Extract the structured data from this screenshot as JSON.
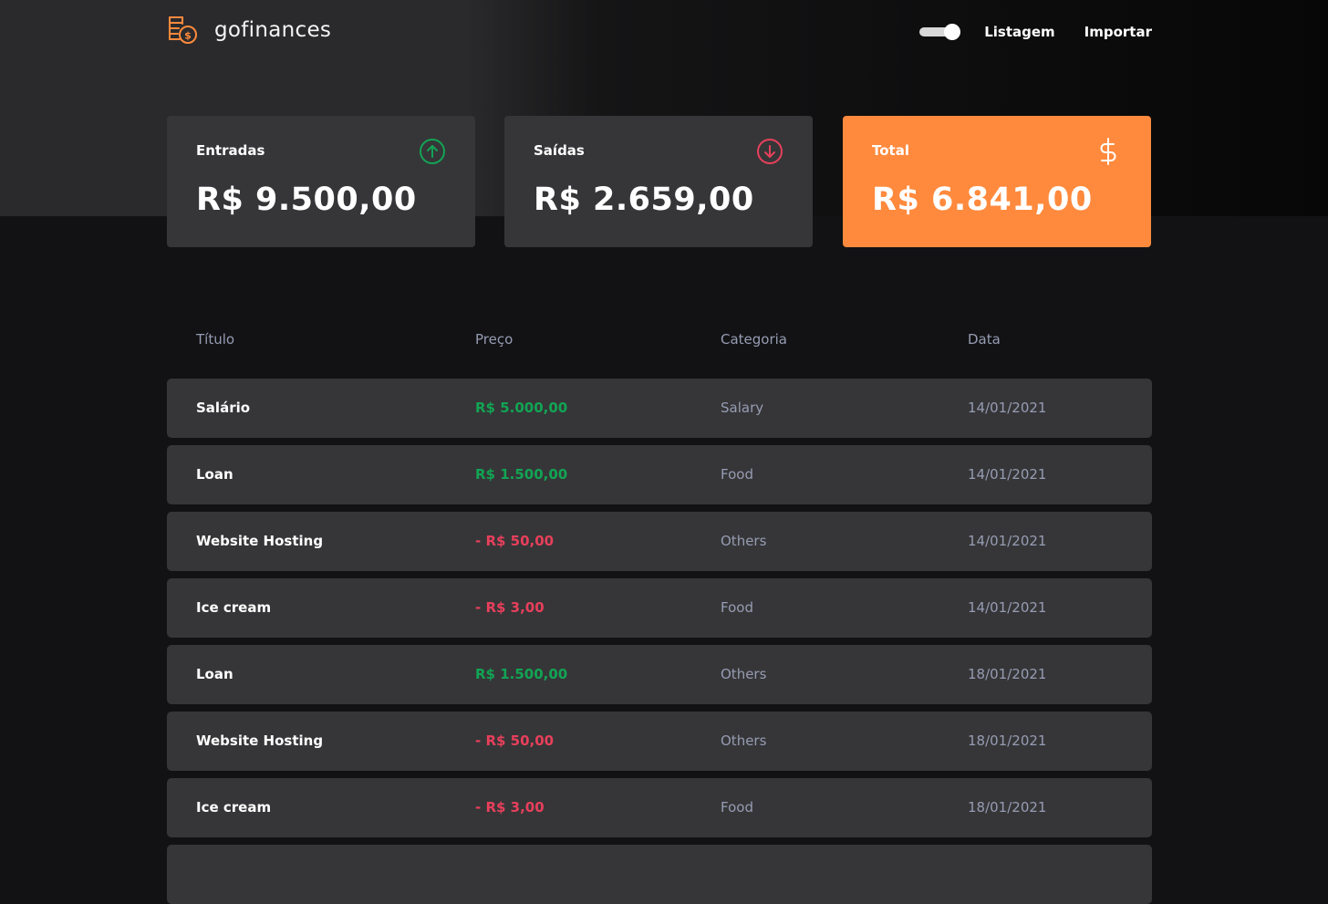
{
  "app": {
    "name": "gofinances"
  },
  "nav": {
    "theme_toggle_on": true,
    "links": [
      "Listagem",
      "Importar"
    ]
  },
  "cards": [
    {
      "label": "Entradas",
      "value": "R$ 9.500,00",
      "icon": "arrow-up-circle-icon",
      "accent": "#12a454"
    },
    {
      "label": "Saídas",
      "value": "R$ 2.659,00",
      "icon": "arrow-down-circle-icon",
      "accent": "#e83f5b"
    },
    {
      "label": "Total",
      "value": "R$ 6.841,00",
      "icon": "dollar-sign-icon",
      "accent": "#ff8a3d"
    }
  ],
  "table": {
    "headers": [
      "Título",
      "Preço",
      "Categoria",
      "Data"
    ],
    "rows": [
      {
        "title": "Salário",
        "price": "R$ 5.000,00",
        "type": "income",
        "category": "Salary",
        "date": "14/01/2021"
      },
      {
        "title": "Loan",
        "price": "R$ 1.500,00",
        "type": "income",
        "category": "Food",
        "date": "14/01/2021"
      },
      {
        "title": "Website Hosting",
        "price": "- R$ 50,00",
        "type": "outcome",
        "category": "Others",
        "date": "14/01/2021"
      },
      {
        "title": "Ice cream",
        "price": "- R$ 3,00",
        "type": "outcome",
        "category": "Food",
        "date": "14/01/2021"
      },
      {
        "title": "Loan",
        "price": "R$ 1.500,00",
        "type": "income",
        "category": "Others",
        "date": "18/01/2021"
      },
      {
        "title": "Website Hosting",
        "price": "- R$ 50,00",
        "type": "outcome",
        "category": "Others",
        "date": "18/01/2021"
      },
      {
        "title": "Ice cream",
        "price": "- R$ 3,00",
        "type": "outcome",
        "category": "Food",
        "date": "18/01/2021"
      }
    ]
  },
  "colors": {
    "background": "#121214",
    "card": "#363638",
    "income": "#12a454",
    "outcome": "#e83f5b",
    "highlight": "#ff8a3d",
    "muted": "#969cb3"
  }
}
